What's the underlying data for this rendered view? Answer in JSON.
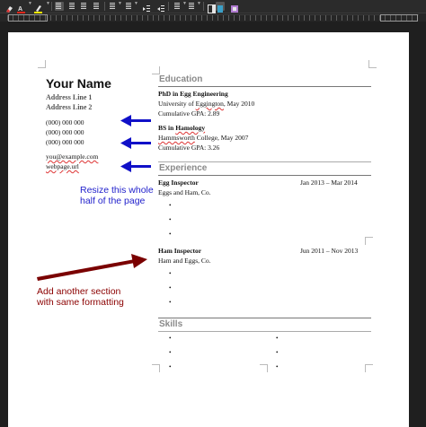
{
  "colors": {
    "toolbar_bg": "#2b2b2b",
    "page_bg": "#ffffff",
    "annotation_blue": "#2222cc",
    "annotation_red": "#8b0000",
    "section_title": "#8a8a8a"
  },
  "toolbar": {
    "icons": [
      "clear-formatting-icon",
      "font-color-icon",
      "highlight-color-icon",
      "align-left-icon",
      "align-center-icon",
      "align-right-icon",
      "justify-icon",
      "bullet-list-icon",
      "numbered-list-icon",
      "indent-increase-icon",
      "indent-decrease-icon",
      "paragraph-icon",
      "sidebar-icon",
      "special-char-icon"
    ]
  },
  "resume": {
    "name": "Your Name",
    "address_line_1": "Address Line 1",
    "address_line_2": "Address Line 2",
    "phones": [
      "(000) 000 000",
      "(000) 000 000",
      "(000) 000 000"
    ],
    "email": "you@example.com",
    "webpage": "webpage.url",
    "education": {
      "title": "Education",
      "degree1": "PhD in Egg Engineering",
      "school1_prefix": "University of ",
      "school1_place": "Eggington",
      "school1_date": ", May 2010",
      "gpa1": "Cumulative GPA: 2.89",
      "degree2_prefix": "BS in ",
      "degree2_subject": "Hamology",
      "school2_name": "Hammsworth",
      "school2_rest": " College, May 2007",
      "gpa2": "Cumulative GPA: 3.26"
    },
    "experience": {
      "title": "Experience",
      "job1_title": "Egg Inspector",
      "job1_dates": "Jan 2013 – Mar 2014",
      "job1_company": "Eggs and Ham, Co.",
      "job2_title": "Ham Inspector",
      "job2_dates": "Jun 2011 – Nov 2013",
      "job2_company": "Ham and Eggs, Co.",
      "bullet": "•"
    },
    "skills": {
      "title": "Skills",
      "bullet": "•"
    }
  },
  "annotations": {
    "resize_line1": "Resize this whole",
    "resize_line2": "half of the page",
    "add_line1": "Add another section",
    "add_line2": "with same formatting"
  }
}
